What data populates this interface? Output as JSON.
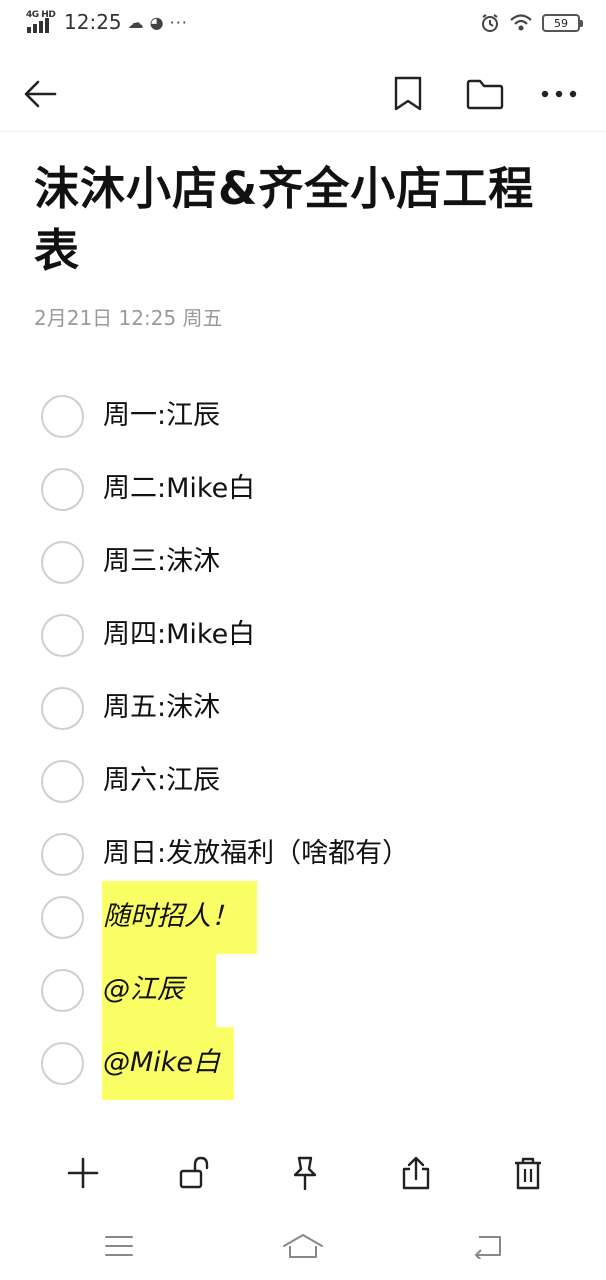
{
  "status_bar": {
    "network": "4G HD",
    "time": "12:25",
    "more_dots": "···",
    "battery": "59"
  },
  "toolbar": {
    "back_icon": "arrow-left-icon",
    "bookmark_icon": "bookmark-icon",
    "folder_icon": "folder-icon",
    "more_icon": "more-horizontal-icon"
  },
  "note": {
    "title": "沫沐小店&齐全小店工程表",
    "date": "2月21日 12:25 周五",
    "items": [
      {
        "text": "周一:江辰",
        "checked": false,
        "highlight": false
      },
      {
        "text": "周二:Mike白",
        "checked": false,
        "highlight": false
      },
      {
        "text": "周三:沫沐",
        "checked": false,
        "highlight": false
      },
      {
        "text": "周四:Mike白",
        "checked": false,
        "highlight": false
      },
      {
        "text": "周五:沫沐",
        "checked": false,
        "highlight": false
      },
      {
        "text": "周六:江辰",
        "checked": false,
        "highlight": false
      },
      {
        "text": "周日:发放福利（啥都有）",
        "checked": false,
        "highlight": false
      },
      {
        "text": "随时招人！",
        "checked": false,
        "highlight": true,
        "highlight_color": "#faff66"
      },
      {
        "text": "@江辰",
        "checked": false,
        "highlight": true,
        "highlight_color": "#faff66"
      },
      {
        "text": "@Mike白",
        "checked": false,
        "highlight": true,
        "highlight_color": "#faff66"
      }
    ]
  },
  "bottom_actions": [
    "add-icon",
    "unlock-icon",
    "pin-icon",
    "share-icon",
    "trash-icon"
  ],
  "system_nav": [
    "menu-icon",
    "home-icon",
    "back-icon"
  ]
}
